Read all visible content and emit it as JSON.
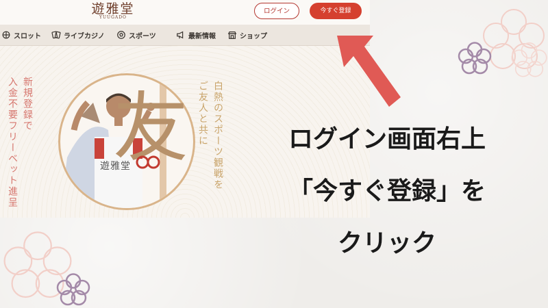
{
  "site": {
    "logo_main": "遊雅堂",
    "logo_sub": "YUUGADO",
    "login_label": "ログイン",
    "register_label": "今すぐ登録",
    "nav": [
      {
        "label": "スロット",
        "icon": "slot-icon"
      },
      {
        "label": "ライブカジノ",
        "icon": "live-casino-icon"
      },
      {
        "label": "スポーツ",
        "icon": "sports-ball-icon"
      },
      {
        "label": "最新情報",
        "icon": "megaphone-icon"
      },
      {
        "label": "ショップ",
        "icon": "shop-icon"
      }
    ],
    "hero": {
      "left_line1": "新規登録で",
      "left_line2": "入金不要フリーベット進呈",
      "right_line1": "白熱のスポーツ観戦を",
      "right_line2": "ご友人と共に",
      "kanji": "友",
      "shirt_text": "遊雅堂"
    }
  },
  "instruction": {
    "line1": "ログイン画面右上",
    "line2": "「今すぐ登録」を",
    "line3": "クリック"
  },
  "colors": {
    "accent_red": "#d5402f",
    "arrow": "#e05a55",
    "gold": "#c9a46a"
  }
}
